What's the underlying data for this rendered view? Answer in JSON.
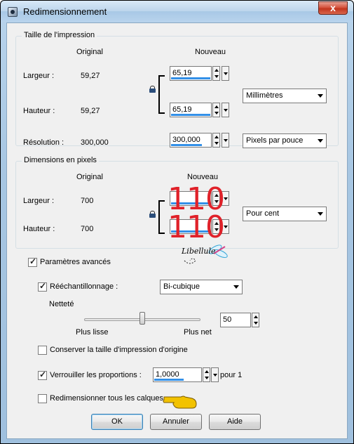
{
  "window": {
    "title": "Redimensionnement",
    "close_glyph": "x"
  },
  "print_size": {
    "title": "Taille de l'impression",
    "col_original": "Original",
    "col_new": "Nouveau",
    "width_label": "Largeur :",
    "width_original": "59,27",
    "width_new": "65,19",
    "height_label": "Hauteur :",
    "height_original": "59,27",
    "height_new": "65,19",
    "resolution_label": "Résolution :",
    "resolution_original": "300,000",
    "resolution_new": "300,000",
    "unit_select": "Millimètres",
    "resolution_unit_select": "Pixels par pouce"
  },
  "pixel_dims": {
    "title": "Dimensions en pixels",
    "col_original": "Original",
    "col_new": "Nouveau",
    "width_label": "Largeur :",
    "width_original": "700",
    "width_new": "110",
    "height_label": "Hauteur :",
    "height_original": "700",
    "height_new": "110",
    "unit_select": "Pour cent"
  },
  "watermark": {
    "text": "Libellule"
  },
  "advanced": {
    "advanced_label": "Paramètres avancés",
    "resample_label": "Rééchantillonnage :",
    "resample_select": "Bi-cubique",
    "sharpness_label": "Netteté",
    "slider_min_label": "Plus lisse",
    "slider_max_label": "Plus net",
    "sharpness_value": "50",
    "sharpness_fraction": 0.5,
    "keep_print_size_label": "Conserver la taille d'impression d'origine",
    "lock_ratio_label": "Verrouiller les proportions :",
    "ratio_value": "1,0000",
    "ratio_suffix": "pour 1",
    "resize_layers_label": "Redimensionner tous les calques"
  },
  "checkboxes": {
    "advanced": true,
    "resample": true,
    "keep_print_size": false,
    "lock_ratio": true,
    "resize_layers": false
  },
  "buttons": {
    "ok": "OK",
    "cancel": "Annuler",
    "help": "Aide"
  },
  "colors": {
    "accent": "#3390e8",
    "overlay_red": "#e0222a",
    "pointer": "#f2c200"
  }
}
